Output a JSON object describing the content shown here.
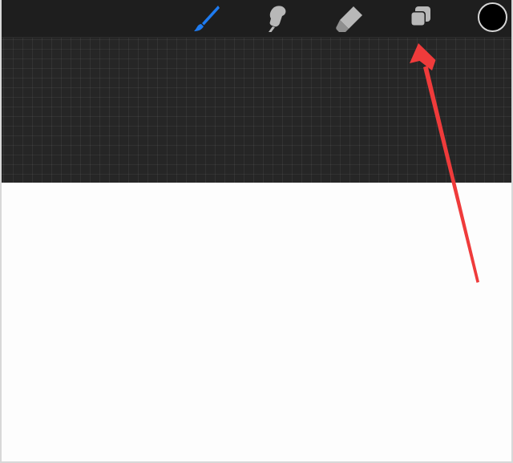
{
  "toolbar": {
    "tools": [
      {
        "id": "brush",
        "icon": "brush-icon",
        "active": true
      },
      {
        "id": "smudge",
        "icon": "smudge-icon",
        "active": false
      },
      {
        "id": "eraser",
        "icon": "eraser-icon",
        "active": false
      },
      {
        "id": "layers",
        "icon": "layers-icon",
        "active": false
      }
    ],
    "current_color": "#000000"
  },
  "colors": {
    "toolbar_bg": "#1e1e1e",
    "active_tool": "#1e7bf0",
    "inactive_tool": "#b8b8b8",
    "annotation_arrow": "#ef3b3b"
  },
  "annotation": {
    "type": "arrow",
    "points_to": "layers-button"
  }
}
